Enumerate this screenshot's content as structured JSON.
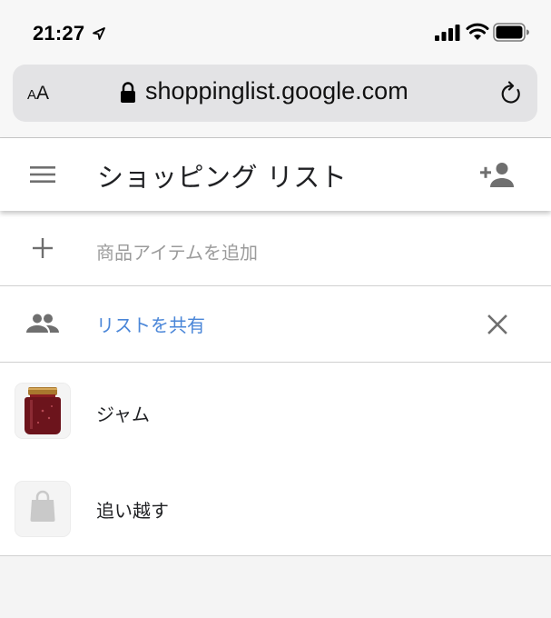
{
  "status_bar": {
    "time": "21:27",
    "icons": [
      "location-arrow-icon",
      "signal-icon",
      "wifi-icon",
      "battery-icon"
    ]
  },
  "address_bar": {
    "aa_small": "A",
    "aa_big": "A",
    "url": "shoppinglist.google.com",
    "icons": [
      "lock-icon",
      "reload-icon"
    ]
  },
  "app": {
    "title": "ショッピング リスト",
    "add_item_placeholder": "商品アイテムを追加",
    "share_label": "リストを共有",
    "items": [
      {
        "label": "ジャム",
        "thumbnail": "jam-jar-image"
      },
      {
        "label": "追い越す",
        "thumbnail": "shopping-bag-icon"
      }
    ]
  },
  "colors": {
    "link": "#4a86d8",
    "icon_gray": "#6f6f6f",
    "placeholder": "#9b9b9b",
    "address_bar_bg": "#e3e3e5"
  }
}
